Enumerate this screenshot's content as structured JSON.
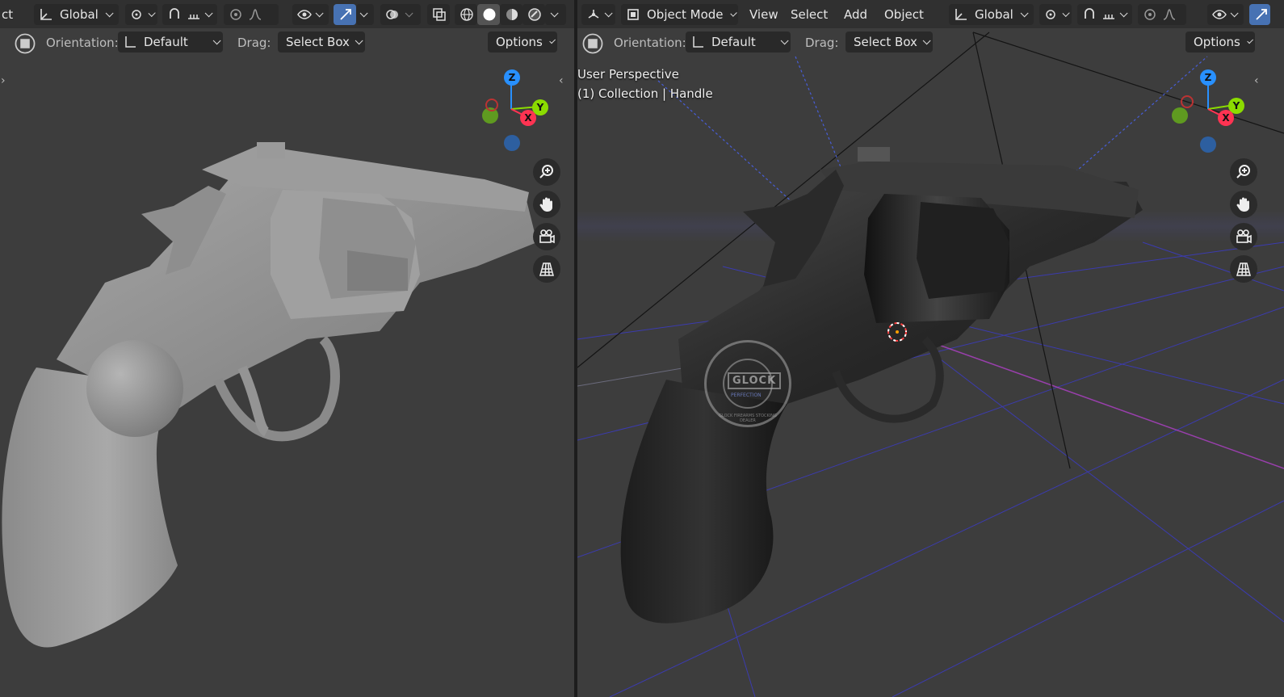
{
  "left_viewport": {
    "header": {
      "mode_fragment": "ct",
      "transform_space": "Global",
      "orientation_label": "Orientation:",
      "orientation_value": "Default",
      "drag_label": "Drag:",
      "drag_value": "Select Box",
      "options_label": "Options"
    },
    "shading": "solid",
    "gizmo": {
      "x": "X",
      "y": "Y",
      "z": "Z"
    }
  },
  "right_viewport": {
    "header": {
      "object_mode": "Object Mode",
      "menus": [
        "View",
        "Select",
        "Add",
        "Object"
      ],
      "transform_space": "Global",
      "orientation_label": "Orientation:",
      "orientation_value": "Default",
      "drag_label": "Drag:",
      "drag_value": "Select Box",
      "options_label": "Options"
    },
    "overlay": {
      "perspective": "User Perspective",
      "collection": "(1) Collection | Handle"
    },
    "watermark": {
      "text": "GLOCK FIREARMS STOCKING DEALER",
      "logo": "GLOCK",
      "sub": "PERFECTION"
    },
    "gizmo": {
      "x": "X",
      "y": "Y",
      "z": "Z"
    }
  },
  "colors": {
    "accent": "#4772b3",
    "axis_x": "#ff3352",
    "axis_y": "#8bdc00",
    "axis_z": "#2890ff",
    "viewport_bg": "#3d3d3d",
    "header_bg": "#303030"
  },
  "icons": {
    "nav": [
      "zoom-icon",
      "pan-hand-icon",
      "camera-icon",
      "grid-view-icon"
    ],
    "toolbar": [
      "transform-orientation-icon",
      "pivot-icon",
      "snap-icon",
      "proportional-icon",
      "visibility-icon",
      "gizmo-icon",
      "overlay-icon",
      "xray-icon",
      "shading-wireframe-icon",
      "shading-solid-icon",
      "shading-material-icon",
      "shading-rendered-icon"
    ]
  }
}
